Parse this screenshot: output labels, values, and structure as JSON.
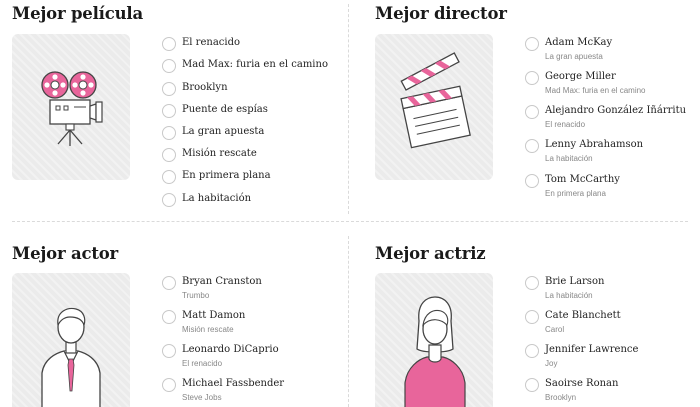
{
  "sections": {
    "pelicula": {
      "title": "Mejor película",
      "options": [
        {
          "label": "El renacido"
        },
        {
          "label": "Mad Max: furia en el camino"
        },
        {
          "label": "Brooklyn"
        },
        {
          "label": "Puente de espías"
        },
        {
          "label": "La gran apuesta"
        },
        {
          "label": "Misión rescate"
        },
        {
          "label": "En primera plana"
        },
        {
          "label": "La habitación"
        }
      ]
    },
    "director": {
      "title": "Mejor director",
      "options": [
        {
          "label": "Adam McKay",
          "sub": "La gran apuesta"
        },
        {
          "label": "George Miller",
          "sub": "Mad Max: furia en el camino"
        },
        {
          "label": "Alejandro González Iñárritu",
          "sub": "El renacido"
        },
        {
          "label": "Lenny Abrahamson",
          "sub": "La habitación"
        },
        {
          "label": "Tom McCarthy",
          "sub": "En primera plana"
        }
      ]
    },
    "actor": {
      "title": "Mejor actor",
      "options": [
        {
          "label": "Bryan Cranston",
          "sub": "Trumbo"
        },
        {
          "label": "Matt Damon",
          "sub": "Misión rescate"
        },
        {
          "label": "Leonardo DiCaprio",
          "sub": "El renacido"
        },
        {
          "label": "Michael Fassbender",
          "sub": "Steve Jobs"
        }
      ]
    },
    "actriz": {
      "title": "Mejor actriz",
      "options": [
        {
          "label": "Brie Larson",
          "sub": "La habitación"
        },
        {
          "label": "Cate Blanchett",
          "sub": "Carol"
        },
        {
          "label": "Jennifer Lawrence",
          "sub": "Joy"
        },
        {
          "label": "Saoirse Ronan",
          "sub": "Brooklyn"
        }
      ]
    }
  },
  "colors": {
    "accent": "#e8659b",
    "illustration_bg": "#ebebeb",
    "radio_border": "#c9c9c9",
    "divider": "#dadada"
  },
  "icons": {
    "pelicula": "film-projector-icon",
    "director": "clapperboard-icon",
    "actor": "man-with-tie-icon",
    "actriz": "woman-portrait-icon"
  }
}
